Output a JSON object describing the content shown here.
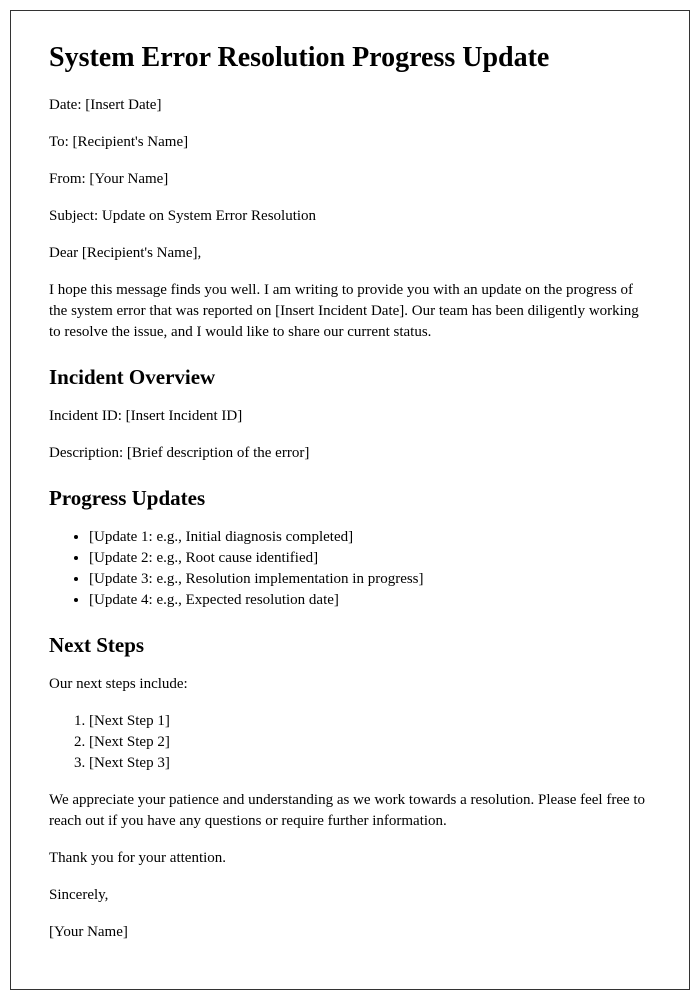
{
  "title": "System Error Resolution Progress Update",
  "header": {
    "date": "Date: [Insert Date]",
    "to": "To: [Recipient's Name]",
    "from": "From: [Your Name]",
    "subject": "Subject: Update on System Error Resolution"
  },
  "salutation": "Dear [Recipient's Name],",
  "intro": "I hope this message finds you well. I am writing to provide you with an update on the progress of the system error that was reported on [Insert Incident Date]. Our team has been diligently working to resolve the issue, and I would like to share our current status.",
  "incident": {
    "heading": "Incident Overview",
    "id": "Incident ID: [Insert Incident ID]",
    "description": "Description: [Brief description of the error]"
  },
  "progress": {
    "heading": "Progress Updates",
    "items": [
      "[Update 1: e.g., Initial diagnosis completed]",
      "[Update 2: e.g., Root cause identified]",
      "[Update 3: e.g., Resolution implementation in progress]",
      "[Update 4: e.g., Expected resolution date]"
    ]
  },
  "next_steps": {
    "heading": "Next Steps",
    "intro": "Our next steps include:",
    "items": [
      "[Next Step 1]",
      "[Next Step 2]",
      "[Next Step 3]"
    ]
  },
  "closing": {
    "appreciation": "We appreciate your patience and understanding as we work towards a resolution. Please feel free to reach out if you have any questions or require further information.",
    "thanks": "Thank you for your attention.",
    "signoff": "Sincerely,",
    "name": "[Your Name]"
  }
}
